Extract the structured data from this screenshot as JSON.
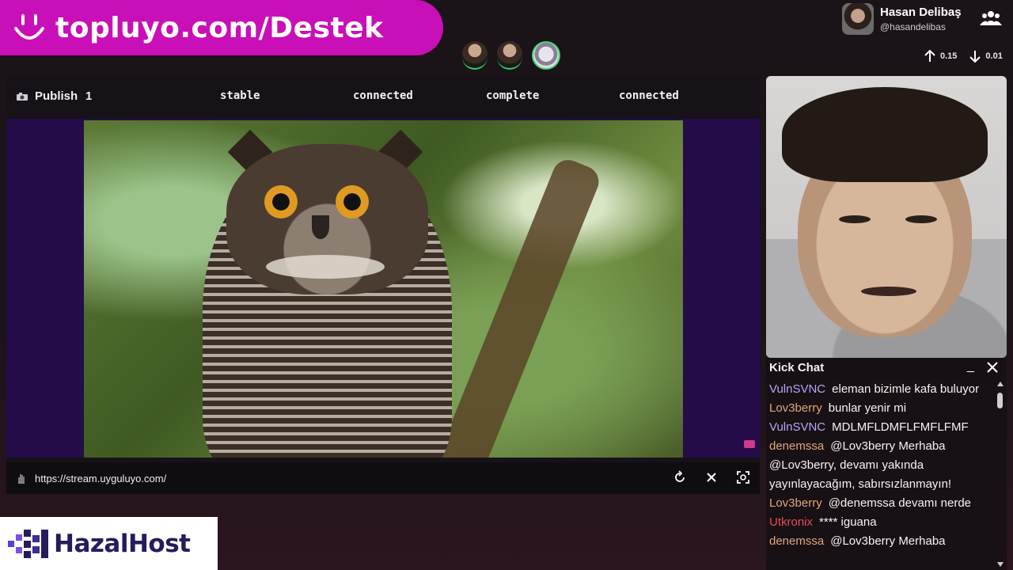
{
  "banner": {
    "url_text": "topluyo.com/Destek",
    "icon": "smiley-icon"
  },
  "viewers": {
    "count_shown": 3
  },
  "profile": {
    "name": "Hasan Delibaş",
    "handle": "@hasandelibas",
    "icon": "group-icon"
  },
  "rates": {
    "up": "0.15",
    "down": "0.01"
  },
  "status": {
    "publish_label": "Publish",
    "publish_count": "1",
    "items": [
      "stable",
      "connected",
      "complete",
      "connected"
    ]
  },
  "url_bar": {
    "url": "https://stream.uyguluyo.com/"
  },
  "chat": {
    "title": "Kick Chat",
    "minimize": "_",
    "messages": [
      {
        "user": "VulnSVNC",
        "color": "#b9a6f5",
        "text": "eleman bizimle kafa buluyor"
      },
      {
        "user": "Lov3berry",
        "color": "#e2a67a",
        "text": "bunlar yenir mi"
      },
      {
        "user": "VulnSVNC",
        "color": "#b9a6f5",
        "text": "MDLMFLDMFLFMFLFMF"
      },
      {
        "user": "denemssa",
        "color": "#e2a67a",
        "text": "@Lov3berry Merhaba @Lov3berry, devamı yakında yayınlayacağım, sabırsızlanmayın!"
      },
      {
        "user": "Lov3berry",
        "color": "#e2a67a",
        "text": "@denemssa devamı nerde"
      },
      {
        "user": "Utkronix",
        "color": "#e84a5a",
        "text": "**** iguana"
      },
      {
        "user": "denemssa",
        "color": "#e2a67a",
        "text": "@Lov3berry Merhaba"
      }
    ]
  },
  "sponsor": {
    "text": "HazalHost"
  }
}
